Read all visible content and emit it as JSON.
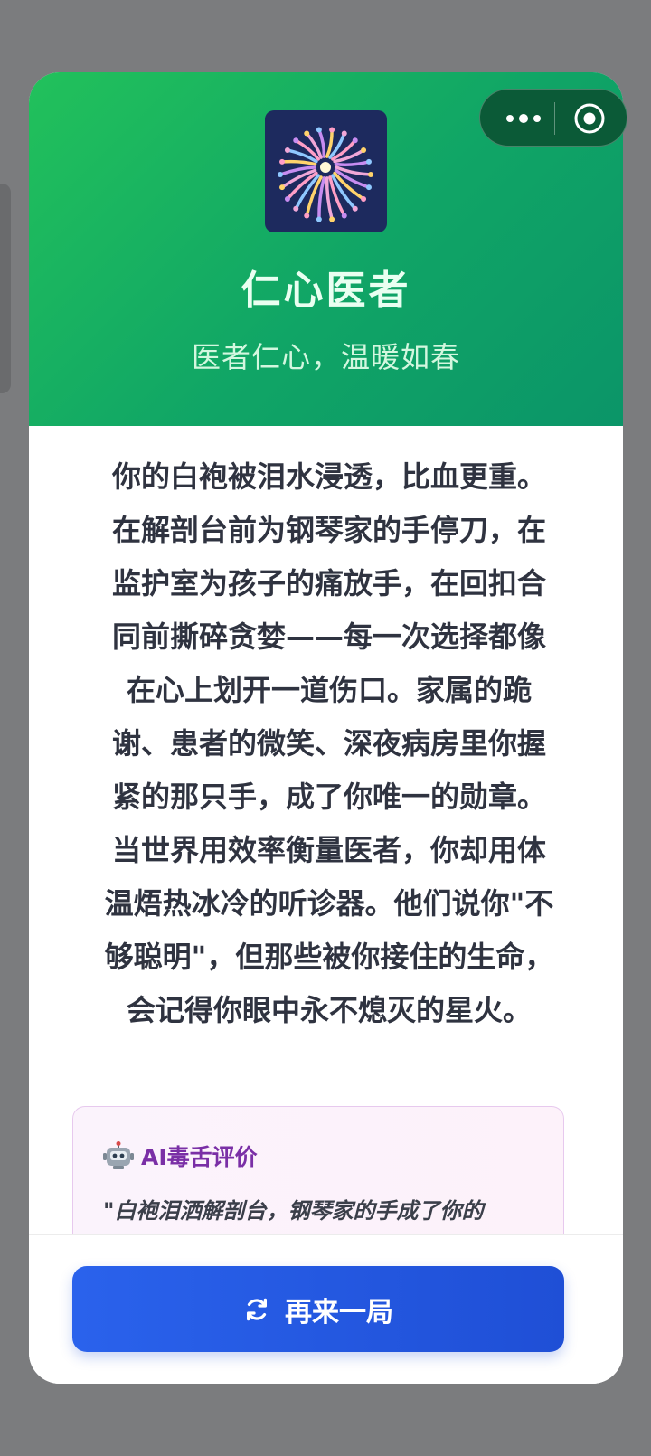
{
  "header": {
    "title": "仁心医者",
    "subtitle": "医者仁心，温暖如春",
    "logo_icon": "fireworks-icon",
    "accent_color": "#18b25f"
  },
  "capsule": {
    "more_icon": "more-dots-icon",
    "close_icon": "target-close-icon"
  },
  "story": {
    "lines": [
      "你的白袍被泪水浸透，比血更重。",
      "在解剖台前为钢琴家的手停刀，在",
      "监护室为孩子的痛放手，在回扣合",
      "同前撕碎贪婪——每一次选择都像",
      "在心上划开一道伤口。家属的跪",
      "谢、患者的微笑、深夜病房里你握",
      "紧的那只手，成了你唯一的勋章。",
      "当世界用效率衡量医者，你却用体",
      "温焐热冰冷的听诊器。他们说你\"不",
      "够聪明\"，但那些被你接住的生命，",
      "会记得你眼中永不熄灭的星火。"
    ]
  },
  "review": {
    "icon": "robot-icon",
    "emoji": "🤖",
    "title": "AI毒舌评价",
    "quote": "\"白袍泪洒解剖台，钢琴家的手成了你的"
  },
  "footer": {
    "button_label": "再来一局",
    "button_icon": "refresh-icon",
    "button_color": "#2558e0"
  }
}
